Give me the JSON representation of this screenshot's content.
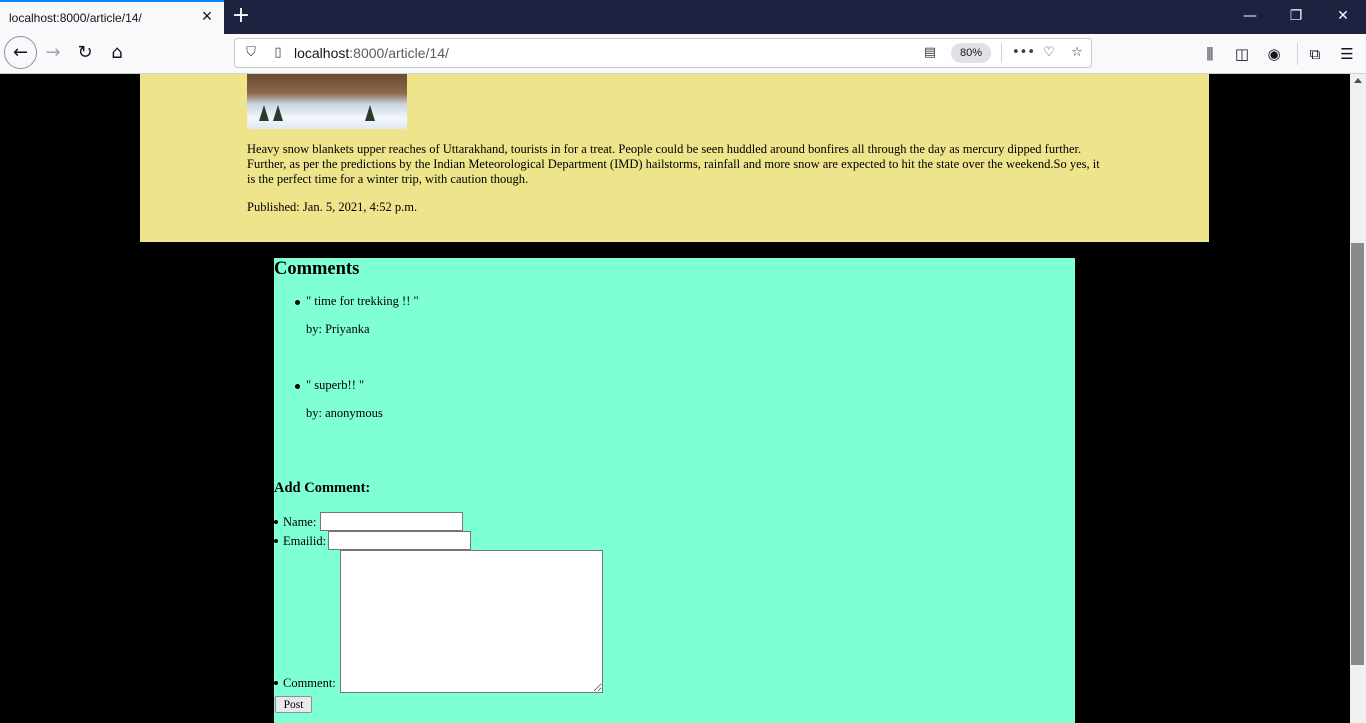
{
  "browser": {
    "tab": {
      "title": "localhost:8000/article/14/"
    },
    "url": {
      "host": "localhost",
      "path": ":8000/article/14/"
    },
    "zoom": "80%"
  },
  "article": {
    "body": "Heavy snow blankets upper reaches of Uttarakhand, tourists in for a treat. People could be seen huddled around bonfires all through the day as mercury dipped further. Further, as per the predictions by the Indian Meteorological Department (IMD) hailstorms, rainfall and more snow are expected to hit the state over the weekend.So yes, it is the perfect time for a winter trip, with caution though.",
    "published": "Published: Jan. 5, 2021, 4:52 p.m."
  },
  "comments": {
    "heading": "Comments",
    "items": [
      {
        "text": "\" time for trekking !! \"",
        "author": "by: Priyanka"
      },
      {
        "text": "\" superb!! \"",
        "author": "by: anonymous"
      }
    ]
  },
  "form": {
    "heading": "Add Comment:",
    "name_label": "Name:",
    "name_value": "",
    "email_label": "Emailid:",
    "email_value": "",
    "comment_label": "Comment:",
    "comment_value": "",
    "post_label": "Post"
  },
  "colors": {
    "article_bg": "#ede48c",
    "comments_bg": "#7fffd4",
    "page_bg": "#000000",
    "tabbar_bg": "#1f2140"
  }
}
